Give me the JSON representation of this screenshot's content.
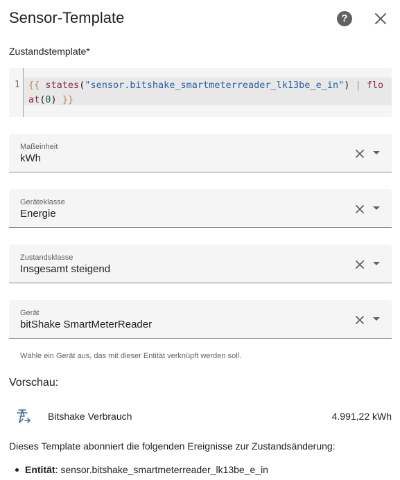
{
  "dialog": {
    "title": "Sensor-Template",
    "help_glyph": "?",
    "help_icon": "help-circle-icon",
    "close_icon": "close-icon"
  },
  "template": {
    "label": "Zustandstemplate*",
    "line_number": "1",
    "tokens": [
      {
        "text": "{{",
        "kind": "brace"
      },
      {
        "text": " ",
        "kind": "plain"
      },
      {
        "text": "states",
        "kind": "fn"
      },
      {
        "text": "(",
        "kind": "plain"
      },
      {
        "text": "\"sensor.bitshake_smartmeterreader_lk13be_e_in\"",
        "kind": "str"
      },
      {
        "text": ")",
        "kind": "plain"
      },
      {
        "text": " | ",
        "kind": "brace"
      },
      {
        "text": "float",
        "kind": "fn"
      },
      {
        "text": "(",
        "kind": "plain"
      },
      {
        "text": "0",
        "kind": "num"
      },
      {
        "text": ")",
        "kind": "plain"
      },
      {
        "text": " ",
        "kind": "plain"
      },
      {
        "text": "}}",
        "kind": "brace"
      }
    ]
  },
  "fields": {
    "unit": {
      "label": "Maßeinheit",
      "value": "kWh"
    },
    "device_class": {
      "label": "Geräteklasse",
      "value": "Energie"
    },
    "state_class": {
      "label": "Zustandsklasse",
      "value": "Insgesamt steigend"
    },
    "device": {
      "label": "Gerät",
      "value": "bitShake SmartMeterReader",
      "helper": "Wähle ein Gerät aus, das mit dieser Entität verknüpft werden soll."
    }
  },
  "preview": {
    "title": "Vorschau:",
    "entity_icon": "transmission-tower-import-icon",
    "entity_name": "Bitshake Verbrauch",
    "entity_state": "4.991,22 kWh",
    "description": "Dieses Template abonniert die folgenden Ereignisse zur Zustandsänderung:",
    "listener_key": "Entität",
    "listener_sep": ": ",
    "listener_value": "sensor.bitshake_smartmeterreader_lk13be_e_in"
  },
  "colors": {
    "field_background": "#f5f5f5",
    "icon_gray": "#616161",
    "code_string": "#2d5fa0",
    "code_function": "#8b2252",
    "code_number": "#116644",
    "code_brace": "#b58a5a"
  }
}
